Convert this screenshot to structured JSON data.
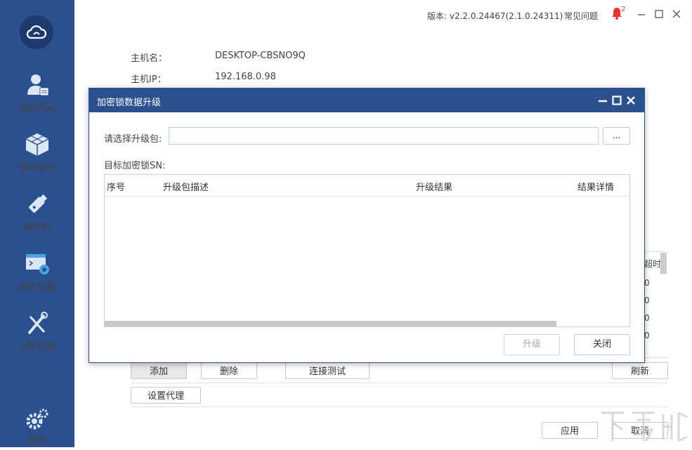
{
  "window": {
    "version": "版本: v2.2.0.24467(2.1.0.24311)",
    "faq": "常见问题",
    "notification_count": "2"
  },
  "sidebar": {
    "items": [
      {
        "label": "我的账号",
        "icon": "account-icon"
      },
      {
        "label": "我的软件",
        "icon": "software-icon"
      },
      {
        "label": "硬件锁",
        "icon": "usb-key-icon"
      },
      {
        "label": "服务设置",
        "icon": "service-settings-icon"
      },
      {
        "label": "诊断修复",
        "icon": "diagnose-icon"
      },
      {
        "label": "高级",
        "icon": "advanced-gear-icon"
      }
    ]
  },
  "host": {
    "name_label": "主机名：",
    "name_value": "DESKTOP-CBSNO9Q",
    "ip_label": "主机IP：",
    "ip_value": "192.168.0.98"
  },
  "background": {
    "column_partial": "超时",
    "row_values": [
      "0",
      "0",
      "0",
      "0"
    ],
    "add_label": "添加",
    "delete_label": "删除",
    "test_label": "连接测试",
    "refresh_label": "刷新",
    "proxy_label": "设置代理",
    "apply_label": "应用",
    "cancel_label": "取消"
  },
  "dialog": {
    "title": "加密锁数据升级",
    "package_label": "请选择升级包:",
    "package_value": "",
    "browse_label": "...",
    "sn_label": "目标加密锁SN:",
    "columns": [
      "序号",
      "升级包描述",
      "升级结果",
      "结果详情"
    ],
    "rows": [],
    "upgrade_label": "升级",
    "close_label": "关闭"
  },
  "colors": {
    "sidebar": "#2b4f8f",
    "dialog_title": "#2b4f8f",
    "notification": "#e33333"
  }
}
